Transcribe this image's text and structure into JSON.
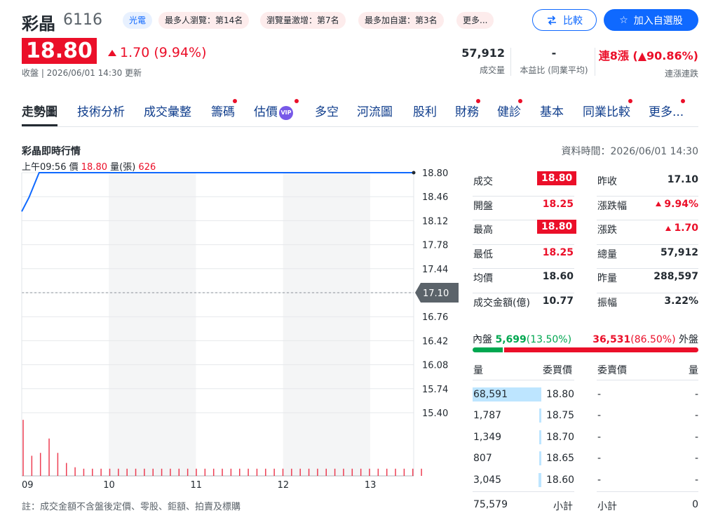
{
  "stock": {
    "name": "彩晶",
    "code": "6116",
    "price": "18.80",
    "change": "1.70 (9.94%)",
    "updated": "收盤 | 2026/06/01 14:30 更新"
  },
  "tags": [
    "光電",
    "最多人瀏覽：第14名",
    "瀏覽量激增：第7名",
    "最多加自選：第3名",
    "更多..."
  ],
  "buttons": {
    "compare": "比較",
    "add_watchlist": "加入自選股"
  },
  "stats": [
    {
      "value": "57,912",
      "label": "成交量"
    },
    {
      "value": "-",
      "label": "本益比 (同業平均)"
    },
    {
      "value": "連8漲 (▲90.86%)",
      "label": "連漲連跌"
    }
  ],
  "tabs": [
    "走勢圖",
    "技術分析",
    "成交彙整",
    "籌碼",
    "估價",
    "多空",
    "河流圖",
    "股利",
    "財務",
    "健診",
    "基本",
    "同業比較",
    "更多..."
  ],
  "vip_label": "VIP",
  "chart_section": {
    "title": "彩晶即時行情",
    "data_time": "資料時間：2026/06/01 14:30",
    "hover_time": "上午09:56",
    "hover_price_label": "價",
    "hover_price": "18.80",
    "hover_vol_label": "量(張)",
    "hover_vol": "626",
    "note": "註：成交金額不含盤後定價、零股、鉅額、拍賣及標購"
  },
  "chart_data": {
    "type": "line",
    "x_ticks": [
      "09",
      "10",
      "11",
      "12",
      "13"
    ],
    "y_ticks": [
      "18.80",
      "18.46",
      "18.12",
      "17.78",
      "17.44",
      "17.10",
      "16.76",
      "16.42",
      "16.08",
      "15.74",
      "15.40"
    ],
    "ylim": [
      15.4,
      18.8
    ],
    "reference_price": "17.10",
    "price_series": [
      {
        "t": "09:00",
        "p": 18.25
      },
      {
        "t": "09:05",
        "p": 18.45
      },
      {
        "t": "09:12",
        "p": 18.8
      },
      {
        "t": "13:30",
        "p": 18.8
      }
    ],
    "volume_bars": [
      3900,
      1400,
      1600,
      2600,
      1600,
      900,
      600,
      500,
      500,
      500,
      500,
      500,
      500,
      500,
      500,
      500,
      500,
      500,
      500,
      500,
      500,
      500,
      500,
      500,
      500,
      500,
      500,
      500,
      500,
      500,
      500,
      500,
      500,
      500,
      500,
      500,
      500,
      500,
      500,
      500,
      500,
      500,
      500,
      500,
      500,
      500,
      500
    ]
  },
  "quote": {
    "left": [
      {
        "label": "成交",
        "value": "18.80",
        "highlight": true
      },
      {
        "label": "開盤",
        "value": "18.25"
      },
      {
        "label": "最高",
        "value": "18.80",
        "highlight": true
      },
      {
        "label": "最低",
        "value": "18.25"
      },
      {
        "label": "均價",
        "value": "18.60"
      },
      {
        "label": "成交金額(億)",
        "value": "10.77"
      }
    ],
    "right": [
      {
        "label": "昨收",
        "value": "17.10"
      },
      {
        "label": "漲跌幅",
        "value": "9.94%",
        "up": true
      },
      {
        "label": "漲跌",
        "value": "1.70",
        "up": true
      },
      {
        "label": "總量",
        "value": "57,912"
      },
      {
        "label": "昨量",
        "value": "288,597"
      },
      {
        "label": "振幅",
        "value": "3.22%"
      }
    ]
  },
  "inout": {
    "inner_label": "內盤",
    "inner_value": "5,699",
    "inner_pct": "(13.50%)",
    "outer_value": "36,531",
    "outer_pct": "(86.50%)",
    "outer_label": "外盤",
    "inner_fraction": 0.135
  },
  "orderbook": {
    "headers": [
      "量",
      "委買價",
      "委賣價",
      "量"
    ],
    "rows": [
      {
        "bid_vol": "68,591",
        "bid": "18.80",
        "ask": "-",
        "ask_vol": "-",
        "fill": 1.0
      },
      {
        "bid_vol": "1,787",
        "bid": "18.75",
        "ask": "-",
        "ask_vol": "-",
        "fill": 0.026
      },
      {
        "bid_vol": "1,349",
        "bid": "18.70",
        "ask": "-",
        "ask_vol": "-",
        "fill": 0.02
      },
      {
        "bid_vol": "807",
        "bid": "18.65",
        "ask": "-",
        "ask_vol": "-",
        "fill": 0.012
      },
      {
        "bid_vol": "3,045",
        "bid": "18.60",
        "ask": "-",
        "ask_vol": "-",
        "fill": 0.044
      }
    ],
    "bid_total": "75,579",
    "subtotal_label": "小計",
    "ask_total": "0"
  },
  "colors": {
    "up": "#eb0f29",
    "down": "#00a750",
    "accent": "#0f69ff",
    "line": "#0f69ff"
  }
}
